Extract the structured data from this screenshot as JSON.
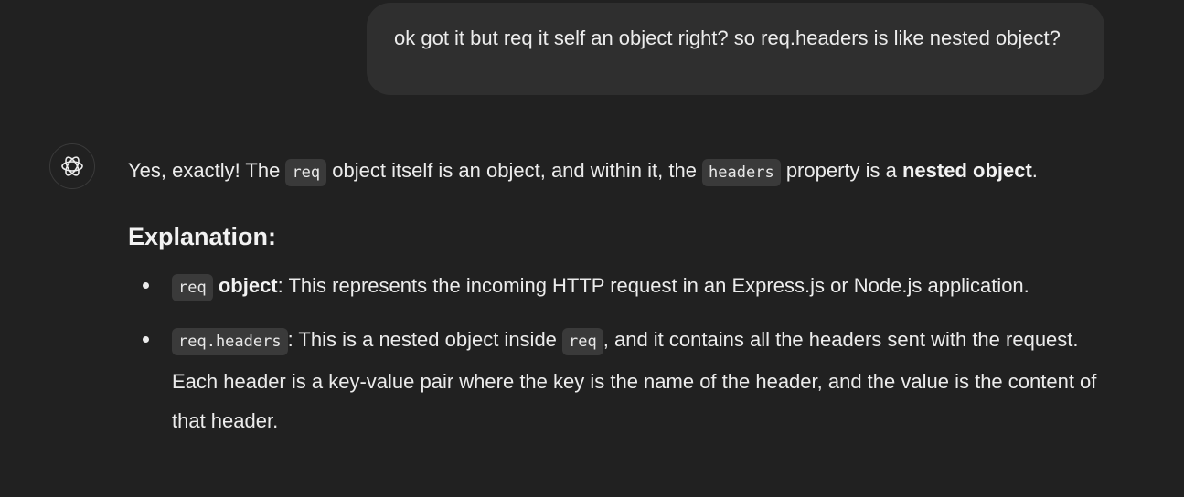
{
  "user_message": {
    "text": "ok got it but req it self an object right? so req.headers is like nested object?"
  },
  "assistant": {
    "avatar_icon": "openai-logo-icon",
    "intro": {
      "t1": "Yes, exactly! The ",
      "c1": "req",
      "t2": " object itself is an object, and within it, the ",
      "c2": "headers",
      "t3": " property is a ",
      "bold": "nested object",
      "t4": "."
    },
    "heading": "Explanation:",
    "bullets": [
      {
        "code": "req",
        "bold": "object",
        "text": ": This represents the incoming HTTP request in an Express.js or Node.js application."
      },
      {
        "code": "req.headers",
        "t1": ": This is a nested object inside ",
        "code2": "req",
        "t2": ", and it contains all the headers sent with the request. Each header is a key-value pair where the key is the name of the header, and the value is the content of that header."
      }
    ]
  }
}
